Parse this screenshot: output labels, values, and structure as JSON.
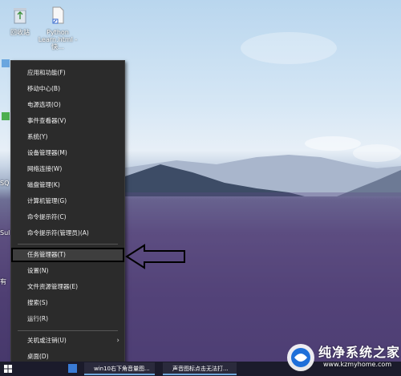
{
  "desktop": {
    "icons": [
      {
        "label": "回收站"
      },
      {
        "label": "Python Learn.html - 快..."
      }
    ],
    "left_labels": [
      "SQ",
      "Sul",
      "有"
    ]
  },
  "context_menu": {
    "items": [
      {
        "label": "应用和功能(F)"
      },
      {
        "label": "移动中心(B)"
      },
      {
        "label": "电源选项(O)"
      },
      {
        "label": "事件查看器(V)"
      },
      {
        "label": "系统(Y)"
      },
      {
        "label": "设备管理器(M)"
      },
      {
        "label": "网络连接(W)"
      },
      {
        "label": "磁盘管理(K)"
      },
      {
        "label": "计算机管理(G)"
      },
      {
        "label": "命令提示符(C)"
      },
      {
        "label": "命令提示符(管理员)(A)"
      },
      {
        "label": "任务管理器(T)",
        "highlighted": true
      },
      {
        "label": "设置(N)"
      },
      {
        "label": "文件资源管理器(E)"
      },
      {
        "label": "搜索(S)"
      },
      {
        "label": "运行(R)"
      },
      {
        "label": "关机或注销(U)",
        "submenu": true
      },
      {
        "label": "桌面(D)"
      }
    ]
  },
  "taskbar": {
    "items": [
      {
        "label": "win10右下角音量图..."
      },
      {
        "label": "声音图标点击无法打..."
      }
    ]
  },
  "watermark": {
    "title": "纯净系统之家",
    "url": "www.kzmyhome.com"
  },
  "colors": {
    "menu_bg": "#2b2b2b",
    "menu_text": "#f2f2f2",
    "highlight_border": "#000000",
    "taskbar_bg": "#1b1b2b"
  }
}
